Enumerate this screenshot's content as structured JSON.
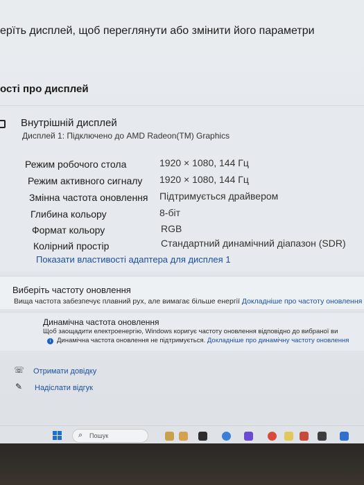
{
  "header": {
    "instruction": "ерїть дисплей, щоб переглянути або змінити його параметри"
  },
  "section": {
    "title": "ості про дисплей"
  },
  "display": {
    "icon": "monitor-icon",
    "name": "Внутрішній дисплей",
    "subtitle": "Дисплей 1: Підключено до AMD Radeon(TM) Graphics",
    "properties": [
      {
        "label": "Режим робочого стола",
        "value": "1920 × 1080, 144 Гц"
      },
      {
        "label": "Режим активного сигналу",
        "value": "1920 × 1080, 144 Гц"
      },
      {
        "label": "Змінна частота оновлення",
        "value": "Підтримується драйвером"
      },
      {
        "label": "Глибина кольору",
        "value": "8-біт"
      },
      {
        "label": "Формат кольору",
        "value": "RGB"
      },
      {
        "label": "Колірний простір",
        "value": "Стандартний динамічний діапазон (SDR)"
      }
    ],
    "adapter_link": "Показати властивості адаптера для дисплея 1"
  },
  "refresh_rate": {
    "title": "Виберіть частоту оновлення",
    "description": "Вища частота забезпечує плавний рух, але вимагає більше енергії",
    "learn_more": "Докладніше про частоту оновлення"
  },
  "dynamic_refresh": {
    "title": "Динамічна частота оновлення",
    "description": "Щоб заощадити електроенергію, Windows коригує частоту оновлення відповідно до вибраної ви",
    "status": "Динамічна частота оновлення не підтримується.",
    "learn_more": "Докладніше про динамічну частоту оновлення"
  },
  "help": {
    "get_help": "Отримати довідку",
    "feedback": "Надіслати відгук"
  },
  "taskbar": {
    "search_placeholder": "Пошук"
  },
  "colors": {
    "accent": "#1a4fa0",
    "window_bg": "#e6e9ed",
    "taskbar_bg": "#dfe3e7"
  }
}
